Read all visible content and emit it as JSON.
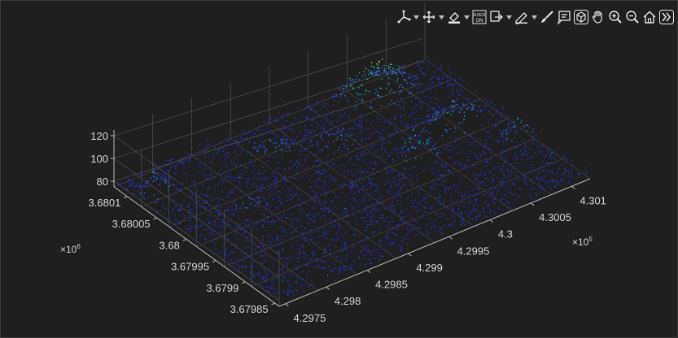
{
  "colors": {
    "background": "#1f1f1f",
    "axis": "#b8b8b8",
    "grid": "#5a5a5a",
    "icon": "#e6e6e6",
    "colormap": [
      "#1a1f8a",
      "#2436c9",
      "#2563e8",
      "#1f8fd8",
      "#13b3b8",
      "#3cc28d",
      "#9fcc4a",
      "#f2d21e"
    ]
  },
  "toolbar": {
    "buttons": [
      {
        "icon": "data-tips-icon",
        "dropdown": true
      },
      {
        "icon": "rotate-axes-icon",
        "dropdown": true
      },
      {
        "icon": "brush-data-icon",
        "dropdown": true
      },
      {
        "icon": "axes-on-icon",
        "dropdown": false,
        "label": "AXES ON"
      },
      {
        "icon": "export-icon",
        "dropdown": true
      },
      {
        "icon": "edit-plot-icon",
        "dropdown": true
      },
      {
        "icon": "paintbrush-icon",
        "dropdown": false
      },
      {
        "icon": "insert-text-icon",
        "dropdown": false
      },
      {
        "icon": "3d-rotate-icon",
        "dropdown": false
      },
      {
        "icon": "pan-icon",
        "dropdown": false
      },
      {
        "icon": "zoom-in-icon",
        "dropdown": false
      },
      {
        "icon": "zoom-out-icon",
        "dropdown": false
      },
      {
        "icon": "home-icon",
        "dropdown": false
      },
      {
        "icon": "expand-icon",
        "dropdown": false
      }
    ],
    "axes_on_label": {
      "line1": "AXES",
      "line2": "ON"
    }
  },
  "chart_data": {
    "type": "scatter",
    "subtype": "3d-point-cloud",
    "title": "",
    "xlabel": "",
    "ylabel": "",
    "zlabel": "",
    "x_ticks": [
      "4.2975",
      "4.298",
      "4.2985",
      "4.299",
      "4.2995",
      "4.3",
      "4.3005",
      "4.301"
    ],
    "x_exponent": {
      "base": "×10",
      "power": "5"
    },
    "y_ticks": [
      "3.67985",
      "3.6799",
      "3.67995",
      "3.68",
      "3.68005",
      "3.6801"
    ],
    "y_exponent": {
      "base": "×10",
      "power": "6"
    },
    "z_ticks": [
      "80",
      "100",
      "120"
    ],
    "xlim": [
      429750,
      430110
    ],
    "ylim": [
      3679840,
      3680110
    ],
    "zlim": [
      75,
      125
    ],
    "grid": true,
    "colormap": "parula",
    "color_by": "z"
  }
}
